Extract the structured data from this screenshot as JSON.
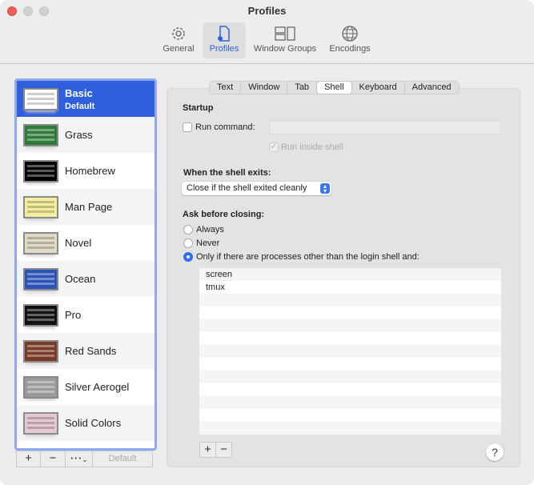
{
  "window": {
    "title": "Profiles"
  },
  "toolbar": [
    {
      "label": "General",
      "icon": "gear-icon"
    },
    {
      "label": "Profiles",
      "icon": "profile-doc-icon"
    },
    {
      "label": "Window Groups",
      "icon": "window-groups-icon"
    },
    {
      "label": "Encodings",
      "icon": "globe-icon"
    }
  ],
  "profiles": [
    {
      "name": "Basic",
      "sub": "Default",
      "color": "#ffffff"
    },
    {
      "name": "Grass",
      "color": "#2f7a3a"
    },
    {
      "name": "Homebrew",
      "color": "#000000"
    },
    {
      "name": "Man Page",
      "color": "#f3eda0"
    },
    {
      "name": "Novel",
      "color": "#e0dbc4"
    },
    {
      "name": "Ocean",
      "color": "#2b53b8"
    },
    {
      "name": "Pro",
      "color": "#111111"
    },
    {
      "name": "Red Sands",
      "color": "#7a3a28"
    },
    {
      "name": "Silver Aerogel",
      "color": "#9a9a9a"
    },
    {
      "name": "Solid Colors",
      "color": "#e8c8d0"
    }
  ],
  "list_buttons": {
    "add": "+",
    "remove": "−",
    "more": "⋯",
    "default": "Default"
  },
  "tabs": [
    "Text",
    "Window",
    "Tab",
    "Shell",
    "Keyboard",
    "Advanced"
  ],
  "shell": {
    "startup": "Startup",
    "run_command": "Run command:",
    "run_command_value": "",
    "run_inside_shell": "Run inside shell",
    "when_exits": "When the shell exits:",
    "exit_option": "Close if the shell exited cleanly",
    "ask_before": "Ask before closing:",
    "radios": [
      "Always",
      "Never",
      "Only if there are processes other than the login shell and:"
    ],
    "processes": [
      "screen",
      "tmux"
    ],
    "add": "+",
    "remove": "−",
    "help": "?"
  }
}
